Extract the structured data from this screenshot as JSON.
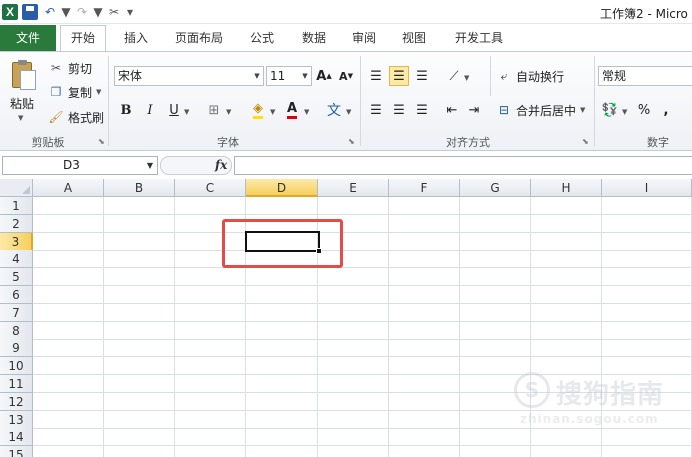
{
  "window": {
    "title": "工作簿2 - Micro"
  },
  "qat": {
    "logo": "X"
  },
  "tabs": [
    "文件",
    "开始",
    "插入",
    "页面布局",
    "公式",
    "数据",
    "审阅",
    "视图",
    "开发工具"
  ],
  "clipboard": {
    "paste": "粘贴",
    "cut": "剪切",
    "copy": "复制",
    "format_painter": "格式刷",
    "group_label": "剪贴板"
  },
  "font": {
    "name": "宋体",
    "size": "11",
    "bold": "B",
    "italic": "I",
    "underline": "U",
    "grow": "A",
    "shrink": "A",
    "group_label": "字体"
  },
  "alignment": {
    "wrap_text": "自动换行",
    "merge_center": "合并后居中",
    "group_label": "对齐方式"
  },
  "number": {
    "format": "常规",
    "percent": "%",
    "comma": ",",
    "group_label": "数字"
  },
  "formula_bar": {
    "name_box": "D3",
    "fx": "fx",
    "value": ""
  },
  "sheet": {
    "columns": [
      "A",
      "B",
      "C",
      "D",
      "E",
      "F",
      "G",
      "H",
      "I"
    ],
    "rows": [
      "1",
      "2",
      "3",
      "4",
      "5",
      "6",
      "7",
      "8",
      "9",
      "10",
      "11",
      "12",
      "13",
      "14",
      "15"
    ],
    "selected_column": "D",
    "selected_row": "3"
  },
  "watermark": {
    "text": "搜狗指南",
    "url": "zhinan.sogou.com",
    "logo": "S"
  },
  "colors": {
    "file_tab": "#2a7a3b",
    "highlight": "#e44b4b",
    "selection": "#f6cf5c"
  }
}
